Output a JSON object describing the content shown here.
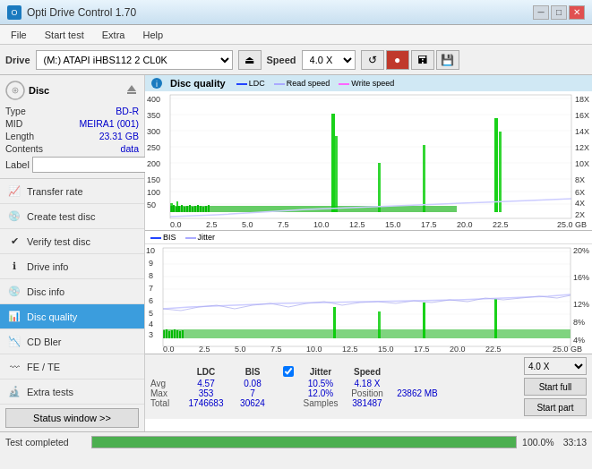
{
  "titleBar": {
    "title": "Opti Drive Control 1.70",
    "minBtn": "─",
    "maxBtn": "□",
    "closeBtn": "✕"
  },
  "menuBar": {
    "items": [
      "File",
      "Start test",
      "Extra",
      "Help"
    ]
  },
  "driveBar": {
    "label": "Drive",
    "driveValue": "(M:)  ATAPI iHBS112  2 CL0K",
    "speedLabel": "Speed",
    "speedValue": "4.0 X"
  },
  "disc": {
    "label": "Disc",
    "typeKey": "Type",
    "typeVal": "BD-R",
    "midKey": "MID",
    "midVal": "MEIRA1 (001)",
    "lengthKey": "Length",
    "lengthVal": "23.31 GB",
    "contentsKey": "Contents",
    "contentsVal": "data",
    "labelKey": "Label",
    "labelVal": ""
  },
  "nav": {
    "items": [
      {
        "id": "transfer-rate",
        "label": "Transfer rate",
        "active": false
      },
      {
        "id": "create-test-disc",
        "label": "Create test disc",
        "active": false
      },
      {
        "id": "verify-test-disc",
        "label": "Verify test disc",
        "active": false
      },
      {
        "id": "drive-info",
        "label": "Drive info",
        "active": false
      },
      {
        "id": "disc-info",
        "label": "Disc info",
        "active": false
      },
      {
        "id": "disc-quality",
        "label": "Disc quality",
        "active": true
      },
      {
        "id": "cd-bler",
        "label": "CD Bler",
        "active": false
      },
      {
        "id": "fe-te",
        "label": "FE / TE",
        "active": false
      },
      {
        "id": "extra-tests",
        "label": "Extra tests",
        "active": false
      }
    ],
    "statusBtn": "Status window >>"
  },
  "chart1": {
    "title": "Disc quality",
    "legend": [
      {
        "label": "LDC",
        "color": "#0000ff"
      },
      {
        "label": "Read speed",
        "color": "#ffffff"
      },
      {
        "label": "Write speed",
        "color": "#ff00ff"
      }
    ]
  },
  "chart2": {
    "legend": [
      {
        "label": "BIS",
        "color": "#0000ff"
      },
      {
        "label": "Jitter",
        "color": "#ffffff"
      }
    ]
  },
  "stats": {
    "headers": [
      "",
      "LDC",
      "BIS",
      "",
      "Jitter",
      "Speed",
      ""
    ],
    "avgRow": [
      "Avg",
      "4.57",
      "0.08",
      "",
      "10.5%",
      "4.18 X",
      ""
    ],
    "maxRow": [
      "Max",
      "353",
      "7",
      "",
      "12.0%",
      "Position",
      "23862 MB"
    ],
    "totalRow": [
      "Total",
      "1746683",
      "30624",
      "",
      "Samples",
      "381487",
      ""
    ],
    "jitterChecked": true,
    "speedDisplay": "4.0 X",
    "startFullBtn": "Start full",
    "startPartBtn": "Start part"
  },
  "bottomBar": {
    "statusText": "Test completed",
    "progress": 100,
    "time": "33:13"
  }
}
